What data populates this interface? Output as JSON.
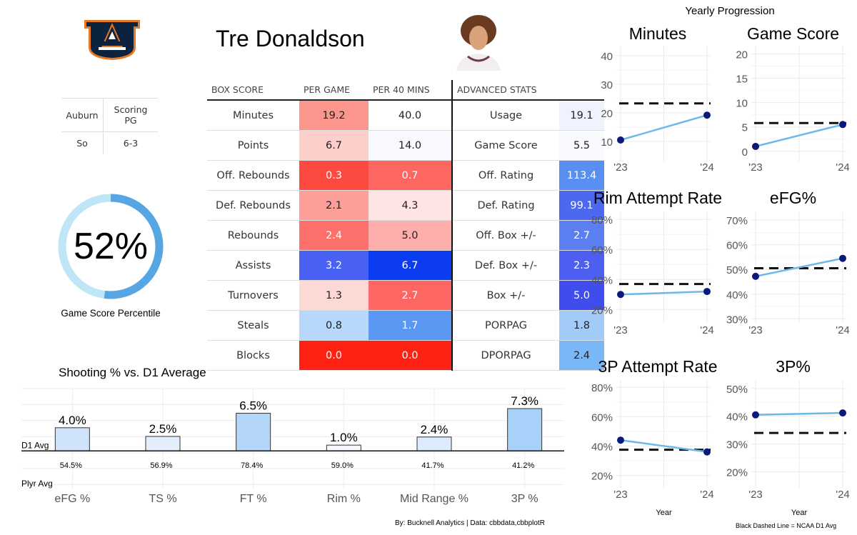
{
  "player": {
    "name": "Tre Donaldson",
    "team": "Auburn",
    "role": "Scoring PG",
    "class": "So",
    "height": "6-3"
  },
  "colors": {
    "auburn_navy": "#0c2340",
    "auburn_orange": "#e87722",
    "line_blue": "#6cb8e8",
    "point_navy": "#0b1a7a",
    "gauge_light": "#bfe6f7",
    "gauge_dark": "#55a6e2"
  },
  "gauge": {
    "value_label": "52%",
    "value": 0.52,
    "label": "Game Score Percentile"
  },
  "stat_table": {
    "headers": [
      "BOX SCORE",
      "PER GAME",
      "PER 40 MINS",
      "ADVANCED STATS",
      ""
    ],
    "rows": [
      {
        "stat": "Minutes",
        "per_game": "19.2",
        "pg_bg": "#fc968d",
        "pg_fg": "#222",
        "per40": "40.0",
        "p40_bg": "#ffffff",
        "p40_fg": "#222",
        "adv": "Usage",
        "adv_val": "19.1",
        "adv_bg": "#eef3fd",
        "adv_fg": "#222"
      },
      {
        "stat": "Points",
        "per_game": "6.7",
        "pg_bg": "#fdcfcb",
        "pg_fg": "#222",
        "per40": "14.0",
        "p40_bg": "#f7f9fe",
        "p40_fg": "#222",
        "adv": "Game Score",
        "adv_val": "5.5",
        "adv_bg": "#f8fafe",
        "adv_fg": "#222"
      },
      {
        "stat": "Off. Rebounds",
        "per_game": "0.3",
        "pg_bg": "#fc4a40",
        "pg_fg": "#fff",
        "per40": "0.7",
        "p40_bg": "#fd6661",
        "p40_fg": "#fff",
        "adv": "Off. Rating",
        "adv_val": "113.4",
        "adv_bg": "#5a8ff2",
        "adv_fg": "#fff"
      },
      {
        "stat": "Def. Rebounds",
        "per_game": "2.1",
        "pg_bg": "#fd9f99",
        "pg_fg": "#222",
        "per40": "4.3",
        "p40_bg": "#fee5e3",
        "p40_fg": "#222",
        "adv": "Def. Rating",
        "adv_val": "99.1",
        "adv_bg": "#4c68ee",
        "adv_fg": "#fff"
      },
      {
        "stat": "Rebounds",
        "per_game": "2.4",
        "pg_bg": "#fd6f6a",
        "pg_fg": "#fff",
        "per40": "5.0",
        "p40_bg": "#fdaeaa",
        "p40_fg": "#222",
        "adv": "Off. Box +/-",
        "adv_val": "2.7",
        "adv_bg": "#5b7ff0",
        "adv_fg": "#fff"
      },
      {
        "stat": "Assists",
        "per_game": "3.2",
        "pg_bg": "#4861f2",
        "pg_fg": "#fff",
        "per40": "6.7",
        "p40_bg": "#0c3cf0",
        "p40_fg": "#fff",
        "adv": "Def. Box +/-",
        "adv_val": "2.3",
        "adv_bg": "#4c5ff0",
        "adv_fg": "#fff"
      },
      {
        "stat": "Turnovers",
        "per_game": "1.3",
        "pg_bg": "#fdd9d6",
        "pg_fg": "#222",
        "per40": "2.7",
        "p40_bg": "#fd6663",
        "p40_fg": "#fff",
        "adv": "Box +/-",
        "adv_val": "5.0",
        "adv_bg": "#3f4cee",
        "adv_fg": "#fff"
      },
      {
        "stat": "Steals",
        "per_game": "0.8",
        "pg_bg": "#b7d8fa",
        "pg_fg": "#222",
        "per40": "1.7",
        "p40_bg": "#5b98f4",
        "p40_fg": "#fff",
        "adv": "PORPAG",
        "adv_val": "1.8",
        "adv_bg": "#a2cbf9",
        "adv_fg": "#222"
      },
      {
        "stat": "Blocks",
        "per_game": "0.0",
        "pg_bg": "#fd2213",
        "pg_fg": "#fff",
        "per40": "0.0",
        "p40_bg": "#fd2213",
        "p40_fg": "#fff",
        "adv": "DPORPAG",
        "adv_val": "2.4",
        "adv_bg": "#7ab7f7",
        "adv_fg": "#222"
      }
    ]
  },
  "footer": {
    "credit": "By: Bucknell Analytics | Data: cbbdata,cbbplotR",
    "legend_note": "Black Dashed Line = NCAA D1 Avg"
  },
  "chart_data": [
    {
      "type": "bar",
      "title": "Shooting % vs. D1 Average",
      "baseline_label": "D1 Avg",
      "player_row_label": "Plyr Avg",
      "categories": [
        "eFG %",
        "TS %",
        "FT %",
        "Rim %",
        "Mid Range %",
        "3P %"
      ],
      "values": [
        4.0,
        2.5,
        6.5,
        1.0,
        2.4,
        7.3
      ],
      "value_labels": [
        "4.0%",
        "2.5%",
        "6.5%",
        "1.0%",
        "2.4%",
        "7.3%"
      ],
      "player_avg": [
        "54.5%",
        "56.9%",
        "78.4%",
        "59.0%",
        "41.7%",
        "41.2%"
      ],
      "bar_colors": [
        "#cfe3fb",
        "#e2eefc",
        "#b4d6fa",
        "#f5f9fe",
        "#ddebfc",
        "#a8d1fa"
      ],
      "ylim": [
        -6,
        11
      ],
      "grid": true
    },
    {
      "type": "line",
      "super_title": "Yearly Progression",
      "xlabel": "Year",
      "x": [
        "'23",
        "'24"
      ],
      "panels": [
        {
          "title": "Minutes",
          "values": [
            10.5,
            19.2
          ],
          "d1_avg": 23.3,
          "ylim": [
            4,
            42
          ],
          "yticks": [
            10,
            20,
            30,
            40
          ],
          "tick_labels": [
            "10",
            "20",
            "30",
            "40"
          ]
        },
        {
          "title": "Game Score",
          "values": [
            1.0,
            5.5
          ],
          "d1_avg": 5.8,
          "ylim": [
            -1.5,
            20.8
          ],
          "yticks": [
            0,
            5,
            10,
            15,
            20
          ],
          "tick_labels": [
            "0",
            "5",
            "10",
            "15",
            "20"
          ]
        },
        {
          "title": "Rim Attempt Rate",
          "values": [
            30,
            32
          ],
          "d1_avg": 37,
          "ylim": [
            13,
            82
          ],
          "yticks": [
            20,
            40,
            60,
            80
          ],
          "tick_labels": [
            "20%",
            "40%",
            "60%",
            "80%"
          ]
        },
        {
          "title": "eFG%",
          "values": [
            47.2,
            54.5
          ],
          "d1_avg": 50.5,
          "ylim": [
            29.5,
            71.5
          ],
          "yticks": [
            30,
            40,
            50,
            60,
            70
          ],
          "tick_labels": [
            "30%",
            "40%",
            "50%",
            "60%",
            "70%"
          ]
        },
        {
          "title": "3P Attempt Rate",
          "values": [
            44,
            36
          ],
          "d1_avg": 37.5,
          "ylim": [
            13,
            82
          ],
          "yticks": [
            20,
            40,
            60,
            80
          ],
          "tick_labels": [
            "20%",
            "40%",
            "60%",
            "80%"
          ]
        },
        {
          "title": "3P%",
          "values": [
            40.5,
            41.2
          ],
          "d1_avg": 34,
          "ylim": [
            15,
            51.5
          ],
          "yticks": [
            20,
            30,
            40,
            50
          ],
          "tick_labels": [
            "20%",
            "30%",
            "40%",
            "50%"
          ]
        }
      ]
    }
  ]
}
